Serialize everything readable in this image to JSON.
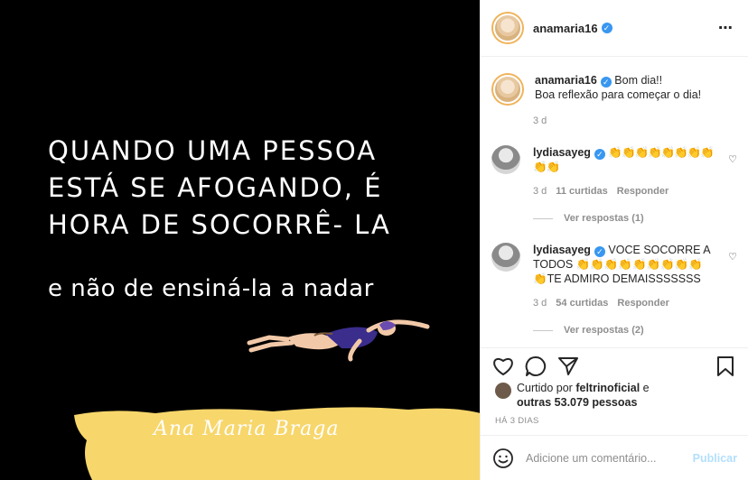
{
  "post": {
    "quote_lines": [
      "QUANDO UMA PESSOA",
      "ESTÁ SE AFOGANDO, É",
      "HORA DE SOCORRÊ- LA"
    ],
    "quote_sub": "e não de ensiná-la a nadar",
    "signature": "Ana Maria Braga"
  },
  "header": {
    "username": "anamaria16",
    "more_icon": "⋯"
  },
  "caption": {
    "username": "anamaria16",
    "text_line1": "Bom dia!!",
    "text_line2": "Boa reflexão para começar o dia!",
    "time": "3 d"
  },
  "comments": [
    {
      "username": "lydiasayeg",
      "text_line1": "👏👏👏👏👏👏👏👏",
      "text_line2": "👏👏",
      "time": "3 d",
      "likes": "11 curtidas",
      "reply": "Responder",
      "view_replies": "Ver respostas (1)"
    },
    {
      "username": "lydiasayeg",
      "text_line1": "VOCE SOCORRE A",
      "text_line2": "TODOS 👏👏👏👏👏👏👏👏👏",
      "text_line3": "👏TE ADMIRO DEMAISSSSSSS",
      "time": "3 d",
      "likes": "54 curtidas",
      "reply": "Responder",
      "view_replies": "Ver respostas (2)"
    }
  ],
  "likes": {
    "prefix": "Curtido por",
    "user": "feltrinoficial",
    "middle": "e",
    "others": "outras 53.079 pessoas"
  },
  "timestamp": "HÁ 3 DIAS",
  "add_comment": {
    "placeholder": "Adicione um comentário...",
    "publish": "Publicar"
  },
  "colors": {
    "verified": "#3897f0",
    "brush": "#f7d66b",
    "link_disabled": "#b2dffc",
    "swimsuit": "#3a2d8c"
  }
}
